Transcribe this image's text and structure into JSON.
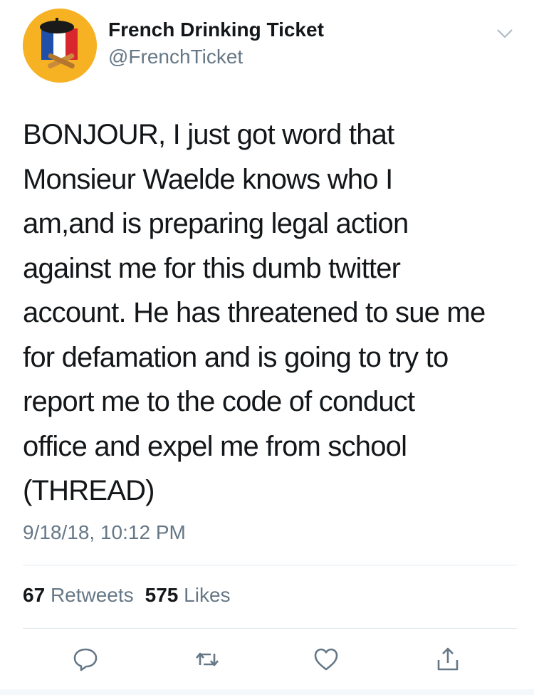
{
  "user": {
    "display_name": "French Drinking Ticket",
    "handle": "@FrenchTicket",
    "avatar_icon": "french-flag-avatar-icon"
  },
  "tweet": {
    "text": "BONJOUR, I just got word that\nMonsieur Waelde knows who I\nam,and is preparing legal action\nagainst me for this dumb twitter\naccount. He has threatened to sue me\nfor defamation and is going to try to\nreport me to the code of conduct\noffice and expel me from school\n(THREAD)",
    "timestamp": "9/18/18, 10:12 PM"
  },
  "stats": {
    "retweets_count": "67",
    "retweets_label": "Retweets",
    "likes_count": "575",
    "likes_label": "Likes"
  },
  "actions": [
    {
      "icon": "reply-icon"
    },
    {
      "icon": "retweet-icon"
    },
    {
      "icon": "like-icon"
    },
    {
      "icon": "share-icon"
    }
  ],
  "colors": {
    "text_primary": "#14171a",
    "text_secondary": "#657786",
    "divider": "#e1e8ed",
    "avatar_background": "#f6b223",
    "action_icon": "#657786"
  }
}
